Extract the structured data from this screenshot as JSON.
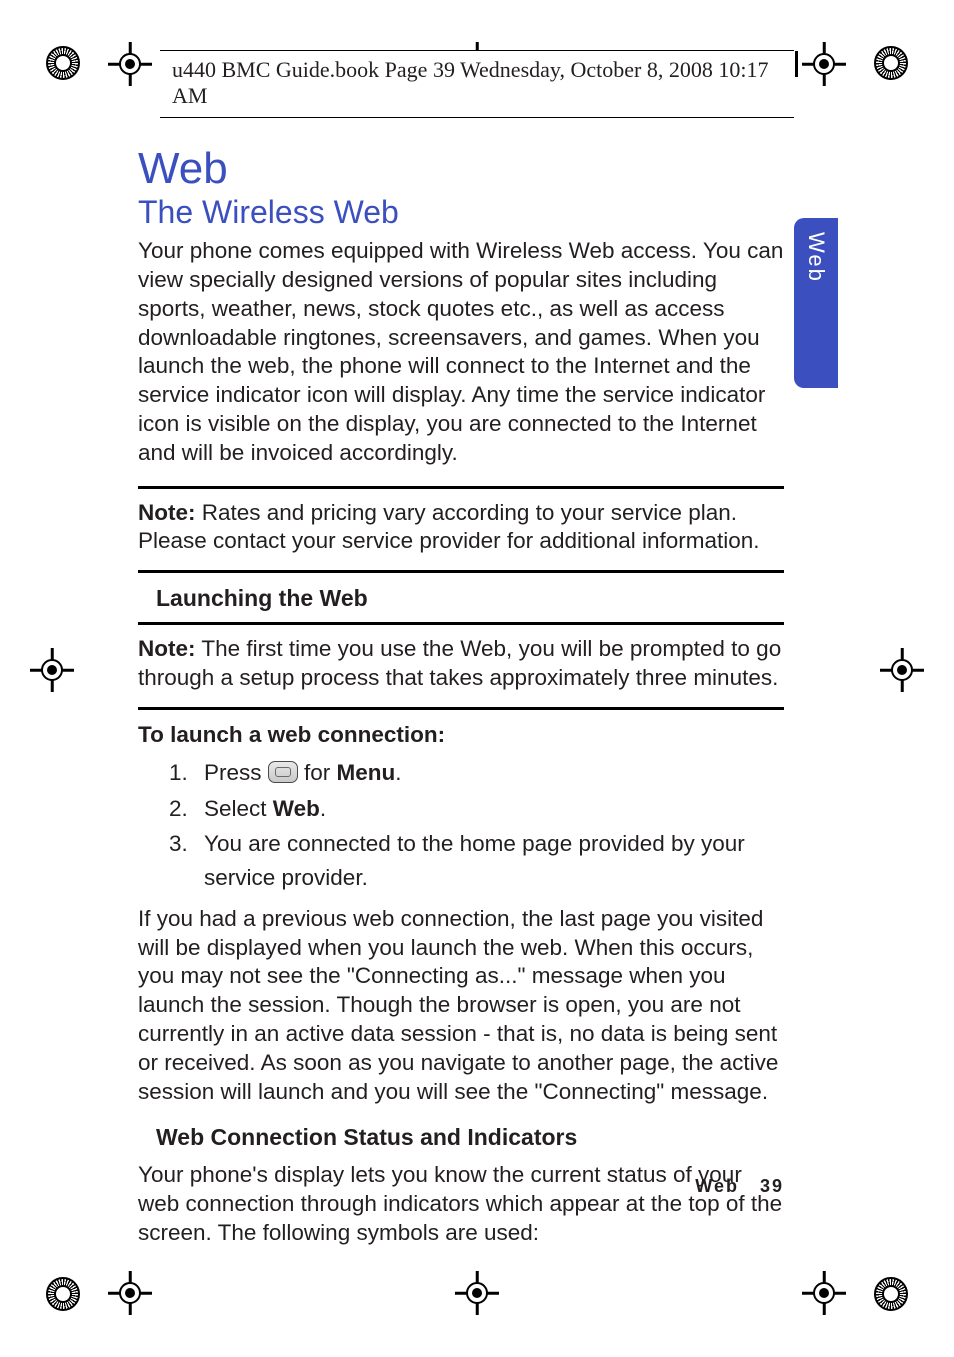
{
  "header": {
    "running_head": "u440 BMC Guide.book  Page 39  Wednesday, October 8, 2008  10:17 AM"
  },
  "tab": {
    "label": "Web"
  },
  "content": {
    "h1": "Web",
    "h2": "The Wireless Web",
    "intro": "Your phone comes equipped with Wireless Web access. You can view specially designed versions of popular sites including sports, weather, news, stock quotes etc., as well as access downloadable ringtones, screensavers, and games. When you launch the web, the phone will connect to the Internet and the service indicator icon will display. Any time the service indicator icon is visible on the display, you are connected to the Internet and will be invoiced accordingly.",
    "note1_label": "Note:",
    "note1_text": " Rates and pricing vary according to your service plan. Please contact your service provider for additional information.",
    "sub_launch": "Launching the Web",
    "note2_label": "Note:",
    "note2_text": " The first time you use the Web, you will be prompted to go through a setup process that takes approximately three minutes.",
    "to_launch_head": "To launch a web connection:",
    "steps": {
      "s1_a": "Press ",
      "s1_b": " for ",
      "s1_menu": "Menu",
      "s1_c": ".",
      "s2_a": "Select ",
      "s2_b": "Web",
      "s2_c": ".",
      "s3": "You are connected to the home page provided by your service provider."
    },
    "para_after": "If you had a previous web connection, the last page you visited will be displayed when you launch the web. When this occurs, you may not see the \"Connecting as...\" message when you launch the session. Though the browser is open, you are not currently in an active data session - that is, no data is being sent or received. As soon as you navigate to another page, the active session will launch and you will see the \"Connecting\" message.",
    "sub_status": "Web Connection Status and Indicators",
    "status_para": "Your phone's display lets you know the current status of your web connection through indicators which appear at the top of the screen. The following symbols are used:"
  },
  "footer": {
    "section": "Web",
    "page": "39"
  }
}
